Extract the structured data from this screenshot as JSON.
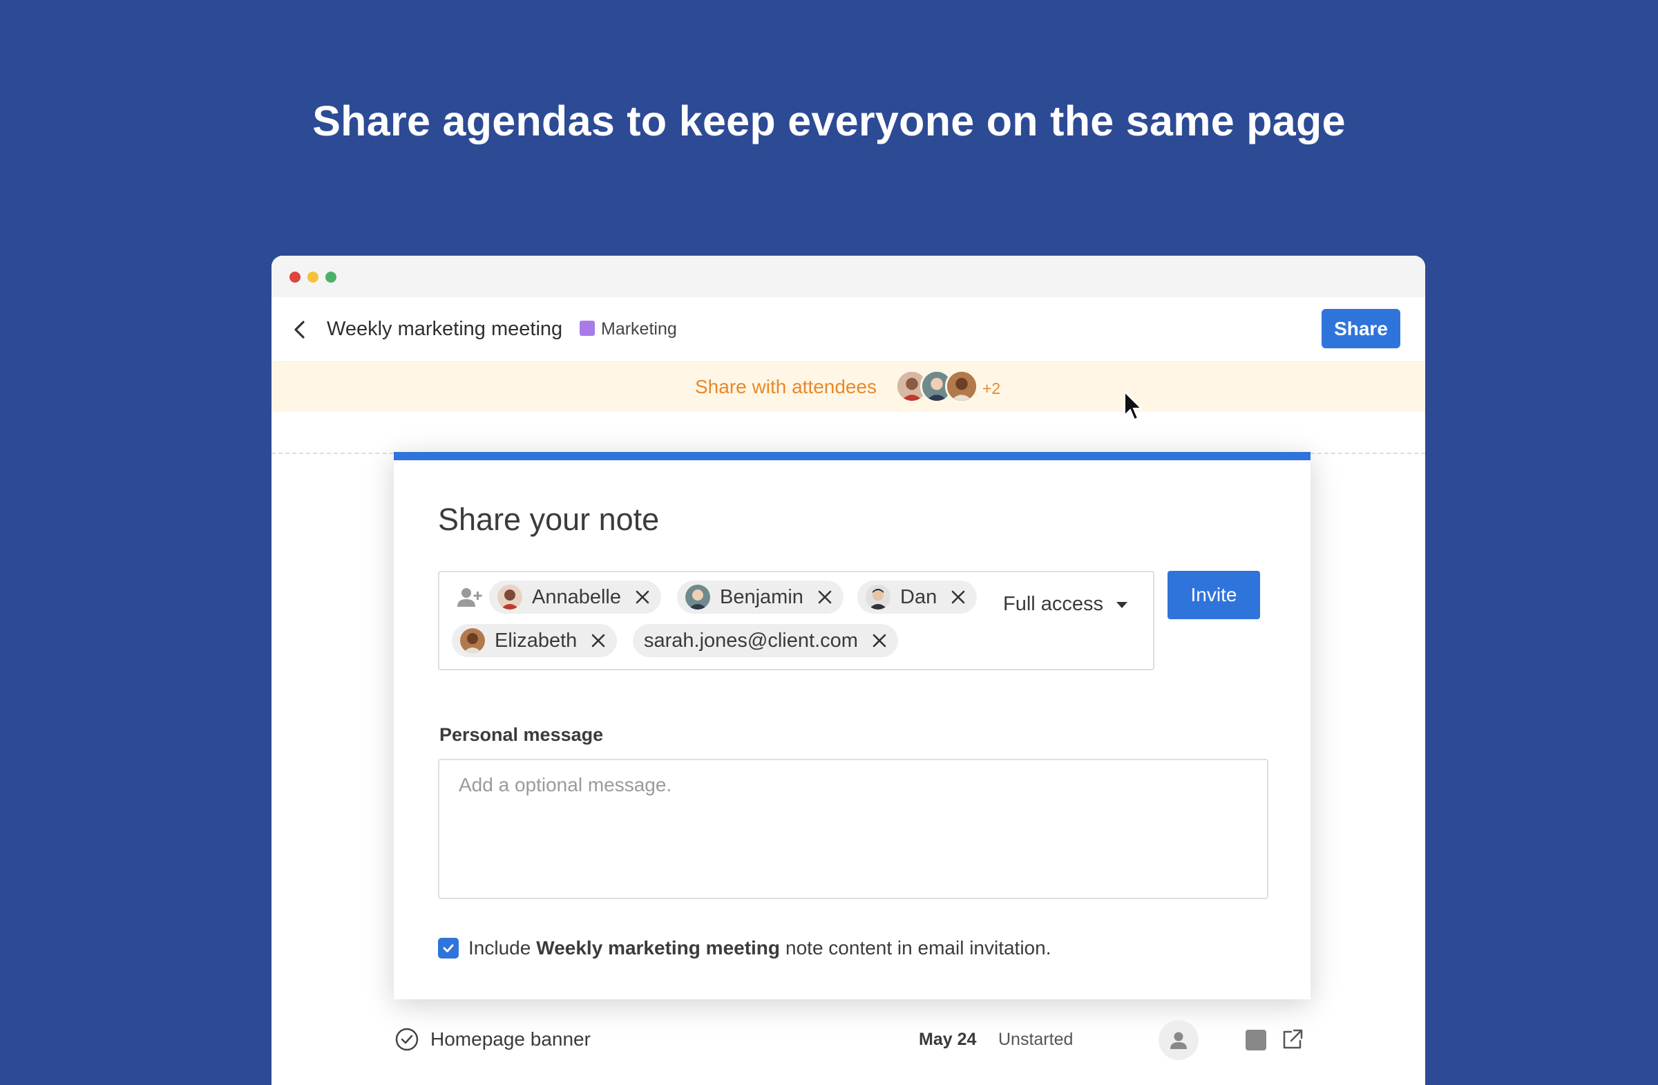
{
  "headline": "Share agendas to keep everyone on the same page",
  "header": {
    "note_title": "Weekly marketing meeting",
    "tag": "Marketing",
    "tag_color": "#a97be8",
    "share_label": "Share"
  },
  "attendees_banner": {
    "text": "Share with attendees",
    "more_count": "+2"
  },
  "modal": {
    "title": "Share your note",
    "recipients": [
      {
        "name": "Annabelle"
      },
      {
        "name": "Benjamin"
      },
      {
        "name": "Dan"
      },
      {
        "name": "Elizabeth"
      },
      {
        "name": "sarah.jones@client.com"
      }
    ],
    "access_label": "Full access",
    "invite_label": "Invite",
    "personal_message_label": "Personal message",
    "personal_message_placeholder": "Add a optional message.",
    "include_prefix": "Include",
    "include_bold": "Weekly marketing meeting",
    "include_suffix": "note content in email invitation.",
    "include_checked": true
  },
  "task": {
    "name": "Homepage banner",
    "date": "May 24",
    "status": "Unstarted"
  },
  "colors": {
    "background": "#2d4a95",
    "accent": "#2f74db",
    "banner_bg": "#fff6e6",
    "banner_text": "#e8882b"
  }
}
